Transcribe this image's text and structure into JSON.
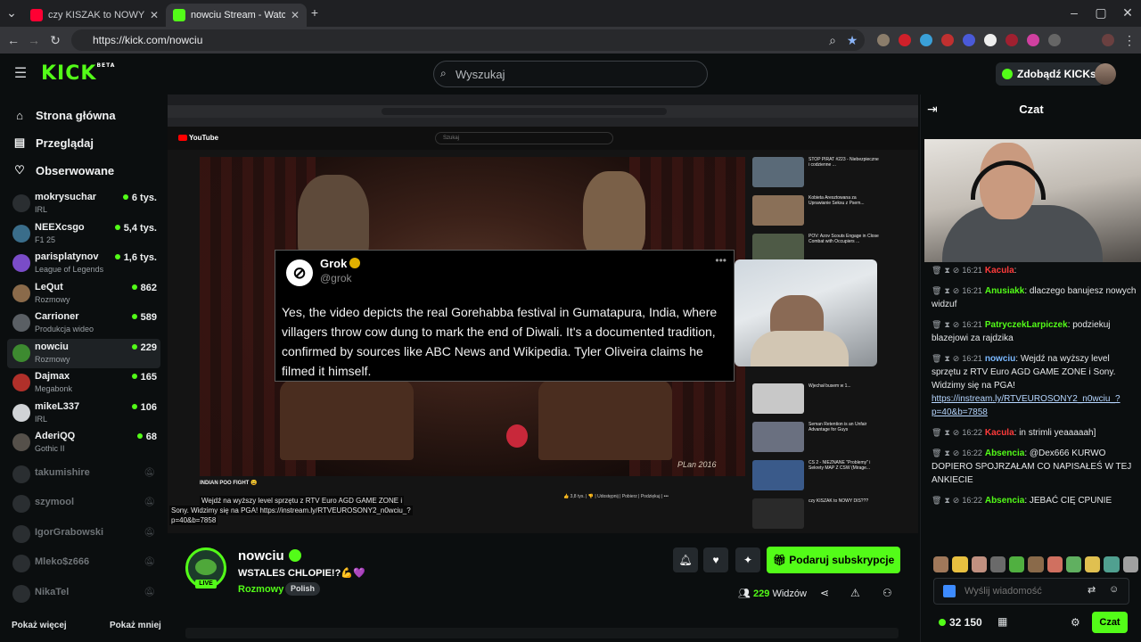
{
  "browser": {
    "tabs": [
      {
        "title": "czy KISZAK to NOWY DIS???",
        "favicon_color": "#ff0033"
      },
      {
        "title": "nowciu Stream - Watch Live",
        "favicon_color": "#53fc18"
      }
    ],
    "url": "https://kick.com/nowciu"
  },
  "header": {
    "logo": "KICK",
    "logo_sup": "BETA",
    "search_placeholder": "Wyszukaj",
    "get_kicks": "Zdobądź KICKs"
  },
  "sidebar": {
    "nav": [
      {
        "label": "Strona główna",
        "icon": "home-icon"
      },
      {
        "label": "Przeglądaj",
        "icon": "browse-icon"
      },
      {
        "label": "Obserwowane",
        "icon": "heart-icon"
      }
    ],
    "channels_live": [
      {
        "name": "mokrysuchar",
        "sub": "IRL",
        "viewers": "6 tys.",
        "color": "#2a2e31"
      },
      {
        "name": "NEEXcsgo",
        "sub": "F1 25",
        "viewers": "5,4 tys.",
        "color": "#3a6d8a"
      },
      {
        "name": "parisplatynov",
        "sub": "League of Legends",
        "viewers": "1,6 tys.",
        "color": "#7a4cc8"
      },
      {
        "name": "LeQut",
        "sub": "Rozmowy",
        "viewers": "862",
        "color": "#8a6a4a"
      },
      {
        "name": "Carrioner",
        "sub": "Produkcja wideo",
        "viewers": "589",
        "color": "#5a5f64"
      },
      {
        "name": "nowciu",
        "sub": "Rozmowy",
        "viewers": "229",
        "color": "#3d8a30"
      },
      {
        "name": "Dajmax",
        "sub": "Megabonk",
        "viewers": "165",
        "color": "#b0302a"
      },
      {
        "name": "mikeL337",
        "sub": "IRL",
        "viewers": "106",
        "color": "#d0d3d6"
      },
      {
        "name": "AderiQQ",
        "sub": "Gothic II",
        "viewers": "68",
        "color": "#55504a"
      }
    ],
    "channels_offline": [
      "takumishire",
      "szymool",
      "IgorGrabowski",
      "Mleko$z666",
      "NikaTel"
    ],
    "show_more": "Pokaż więcej",
    "show_less": "Pokaż mniej"
  },
  "video": {
    "yt_logo": "YouTube",
    "yt_search": "Szukaj",
    "tweet": {
      "name": "Grok",
      "handle": "@grok",
      "text": "Yes, the video depicts the real Gorehabba festival in Gumatapura, India, where villagers throw cow dung to mark the end of Diwali. It's a documented tradition, confirmed by sources like ABC News and Wikipedia. Tyler Oliveira claims he filmed it himself."
    },
    "yt_video_title": "INDIAN POO FIGHT 😩",
    "overlay_chat_line1": "Wejdź na wyższy level sprzętu z RTV Euro AGD GAME ZONE i",
    "overlay_chat_line2": "Sony. Widzimy się na PGA! https://instream.ly/RTVEUROSONY2_n0wciu_?",
    "overlay_chat_line3": "p=40&b=7858",
    "yt_side": [
      "STOP PIRAT #223 - Niebezpieczne i codzienne ...",
      "Kobieta Aresztowana za Uprawianie Seksu z Psem...",
      "POV: Azov Scouts Engage in Close Combat with Occupiers ...",
      "Wjechał busem w 1...",
      "Seman Retention is an Unfair Advantage for Guys",
      "CS 2 - NIEZNANE \"Problemy\" i Sekrety MAP Z CSW (Mirage...",
      "czy KISZAK to NOWY DIS???"
    ]
  },
  "stream": {
    "name": "nowciu",
    "title": "WSTALES CHLOPIE!?💪💜",
    "category": "Rozmowy",
    "tag": "Polish",
    "live": "LIVE",
    "subscribe": "Podaruj subskrypcje",
    "viewers_count": "229",
    "viewers_label": "Widzów"
  },
  "chat": {
    "title": "Czat",
    "messages": [
      {
        "time": "16:21",
        "user": "Kacula",
        "color": "#ff3b3b",
        "text": ""
      },
      {
        "time": "16:21",
        "user": "Anusiakk",
        "color": "#53fc18",
        "text": "dlaczego banujesz nowych widzuf"
      },
      {
        "time": "16:21",
        "user": "PatryczekLarpiczek",
        "color": "#53fc18",
        "text": "podziekuj blazejowi za rajdzika"
      },
      {
        "time": "16:21",
        "user": "nowciu",
        "color": "#7ab8ff",
        "text": "Wejdź na wyższy level sprzętu z RTV Euro AGD GAME ZONE i Sony. Widzimy się na PGA!",
        "link": "https://instream.ly/RTVEUROSONY2_n0wciu_?p=40&b=7858"
      },
      {
        "time": "16:22",
        "user": "Kacula",
        "color": "#ff3b3b",
        "text": "in strimli yeaaaaah]"
      },
      {
        "time": "16:22",
        "user": "Absencia",
        "color": "#53fc18",
        "text": "@Dex666 KURWO DOPIERO SPOJRZAŁAM CO NAPISAŁEŚ W TEJ ANKIECIE"
      },
      {
        "time": "16:22",
        "user": "Absencia",
        "color": "#53fc18",
        "text": "JEBAĆ CIĘ CPUNIE"
      }
    ],
    "input_placeholder": "Wyślij wiadomość",
    "points": "32 150",
    "send": "Czat"
  }
}
